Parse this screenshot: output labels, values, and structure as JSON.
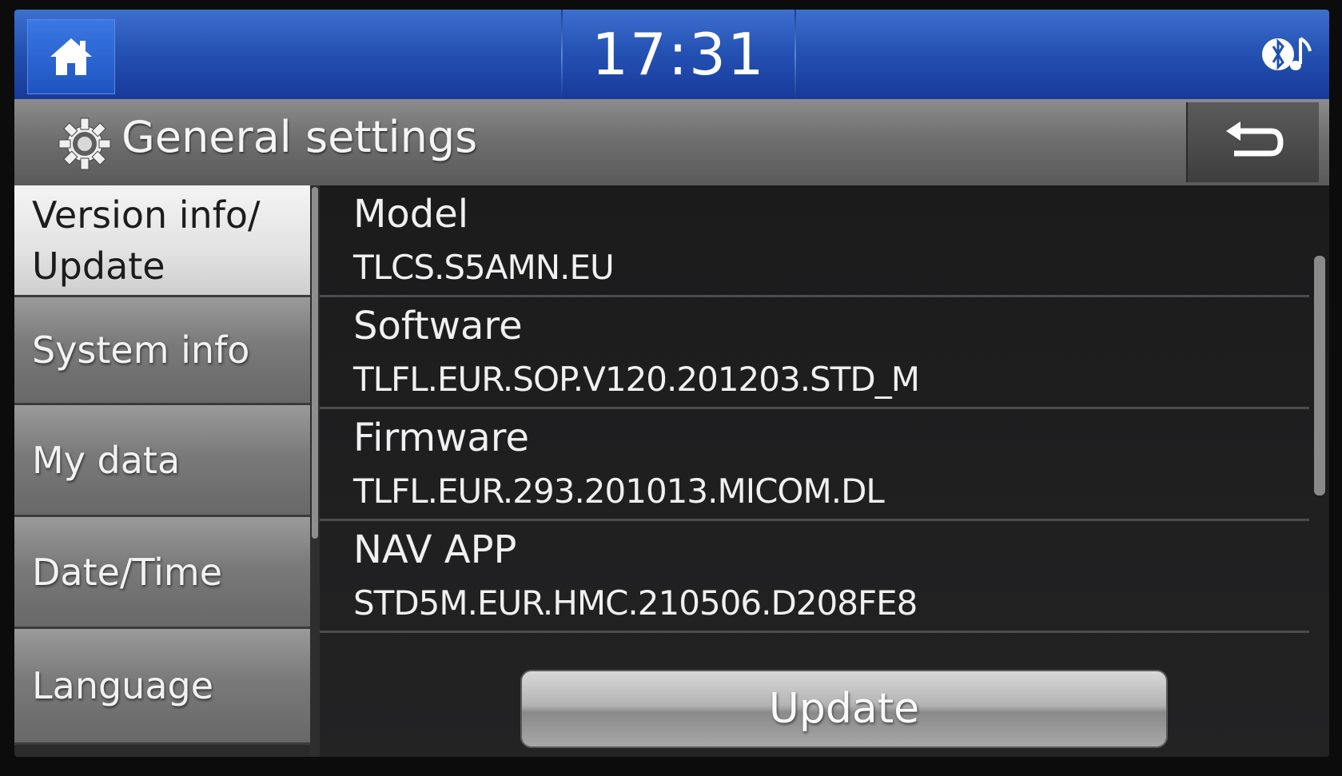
{
  "status_bar": {
    "time": "17:31",
    "home_icon": "home-icon",
    "connectivity_icon": "bluetooth-audio-icon"
  },
  "header": {
    "title": "General settings",
    "icon": "gear-icon",
    "back_icon": "back-arrow-icon"
  },
  "menu": {
    "items": [
      {
        "label": "Version info/ Update",
        "active": true
      },
      {
        "label": "System info",
        "active": false
      },
      {
        "label": "My data",
        "active": false
      },
      {
        "label": "Date/Time",
        "active": false
      },
      {
        "label": "Language",
        "active": false
      }
    ]
  },
  "info": {
    "rows": [
      {
        "label": "Model",
        "value": "TLCS.S5AMN.EU"
      },
      {
        "label": "Software",
        "value": "TLFL.EUR.SOP.V120.201203.STD_M"
      },
      {
        "label": "Firmware",
        "value": "TLFL.EUR.293.201013.MICOM.DL"
      },
      {
        "label": "NAV APP",
        "value": "STD5M.EUR.HMC.210506.D208FE8"
      }
    ]
  },
  "actions": {
    "update_label": "Update"
  }
}
